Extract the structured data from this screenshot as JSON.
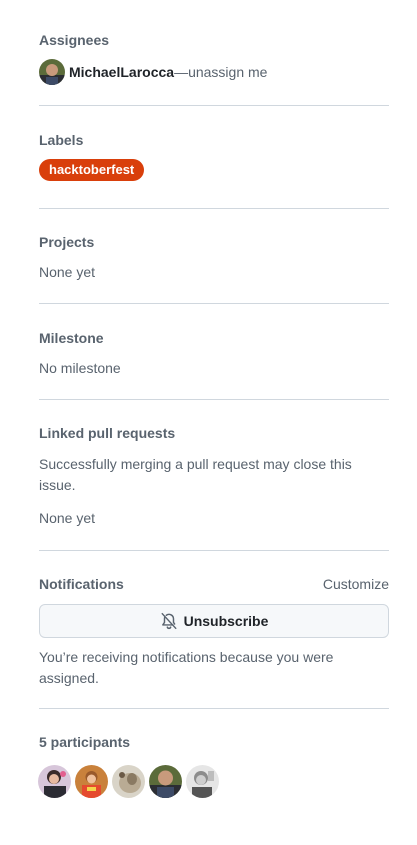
{
  "assignees": {
    "heading": "Assignees",
    "name": "MichaelLarocca",
    "separator": "—",
    "unassign": "unassign me"
  },
  "labels": {
    "heading": "Labels",
    "items": [
      "hacktoberfest"
    ],
    "color": "#d93f0b"
  },
  "projects": {
    "heading": "Projects",
    "value": "None yet"
  },
  "milestone": {
    "heading": "Milestone",
    "value": "No milestone"
  },
  "linked": {
    "heading": "Linked pull requests",
    "description": "Successfully merging a pull request may close this issue.",
    "value": "None yet"
  },
  "notifications": {
    "heading": "Notifications",
    "customize": "Customize",
    "button": "Unsubscribe",
    "button_icon": "bell-slash-icon",
    "reason": "You’re receiving notifications because you were assigned."
  },
  "participants": {
    "heading": "5 participants"
  }
}
